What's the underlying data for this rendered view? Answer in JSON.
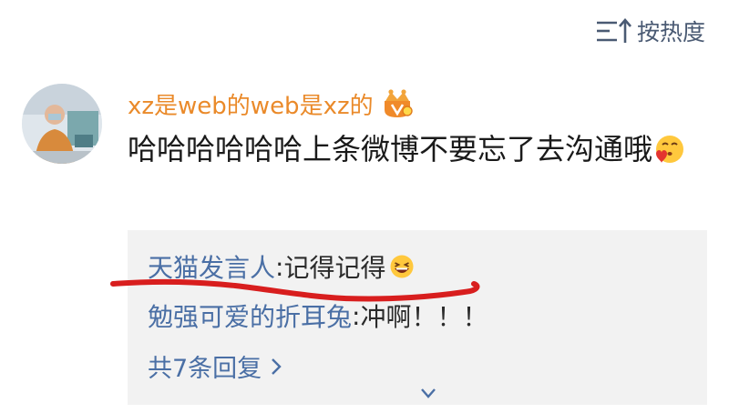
{
  "sort": {
    "label": "按热度",
    "icon": "sort-lines-arrow-icon"
  },
  "comment": {
    "username": "xz是web的web是xz的",
    "badge_icon": "vip-crown-badge-icon",
    "text": "哈哈哈哈哈哈上条微博不要忘了去沟通哦",
    "emoji": "blowing-kiss-emoji"
  },
  "replies": [
    {
      "name": "天猫发言人",
      "separator": ": ",
      "text": "记得记得",
      "emoji": "laughing-emoji"
    },
    {
      "name": "勉强可爱的折耳兔",
      "separator": ": ",
      "text": "冲啊！！！"
    }
  ],
  "more_replies": {
    "label": "共7条回复",
    "icon": "chevron-right-icon"
  },
  "colors": {
    "username": "#ea8a2a",
    "reply_name": "#4a6fa5",
    "reply_bg": "#f2f2f2",
    "annotation": "#d81e1e"
  }
}
